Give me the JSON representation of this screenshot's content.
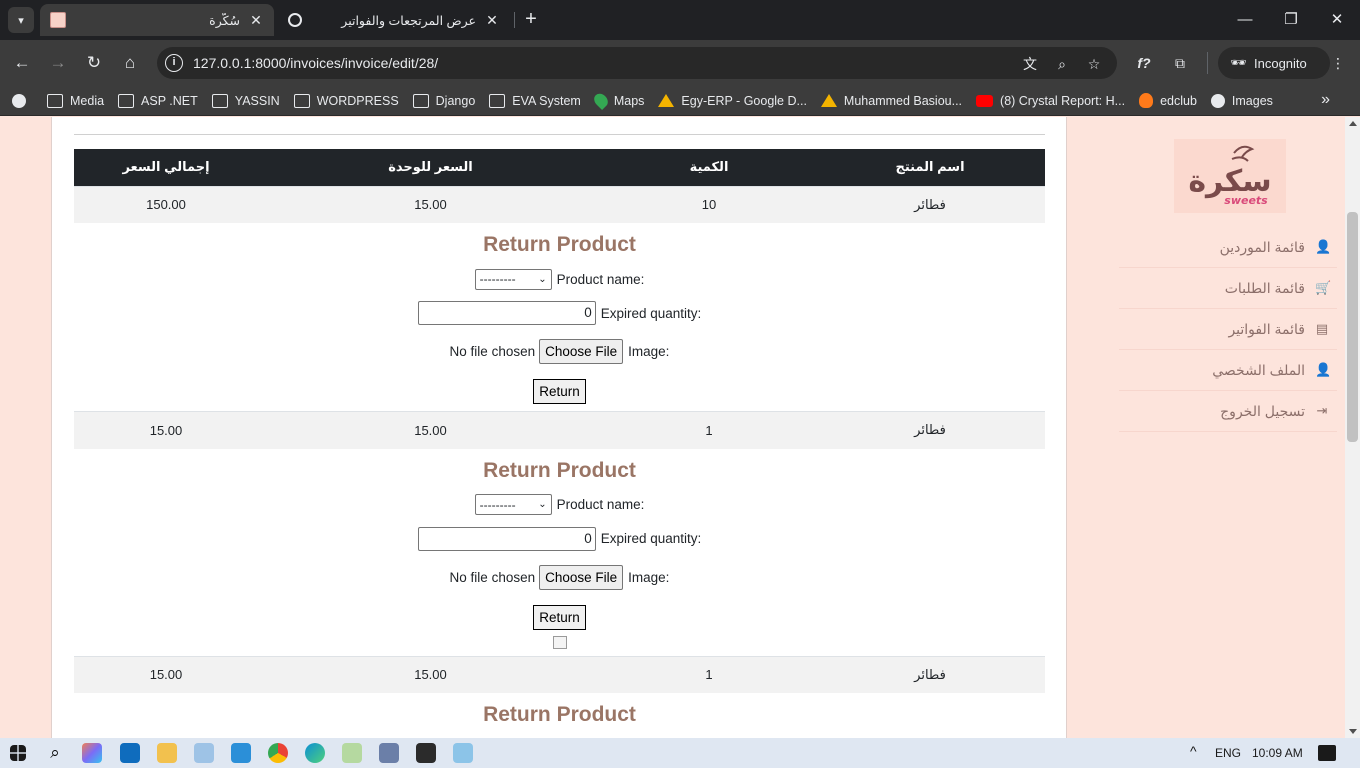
{
  "browser": {
    "tabs": [
      {
        "title": "سُكّرة",
        "active": true
      },
      {
        "title": "عرض المرتجعات والفواتير",
        "active": false
      }
    ],
    "url": "127.0.0.1:8000/invoices/invoice/edit/28/",
    "profile_label": "Incognito",
    "bookmarks": [
      "Media",
      "ASP .NET",
      "YASSIN",
      "WORDPRESS",
      "Django",
      "EVA System",
      "Maps",
      "Egy-ERP - Google D...",
      "Muhammed Basiou...",
      "(8) Crystal Report: H...",
      "edclub",
      "Images"
    ]
  },
  "sidebar": {
    "logo_text": "سكرة",
    "logo_sub": "sweets",
    "items": [
      {
        "label": "قائمة الموردين",
        "icon": "user-icon"
      },
      {
        "label": "قائمة الطلبات",
        "icon": "cart-icon"
      },
      {
        "label": "قائمة الفواتير",
        "icon": "document-icon"
      },
      {
        "label": "الملف الشخصي",
        "icon": "user-icon"
      },
      {
        "label": "تسجيل الخروج",
        "icon": "sign-out-icon"
      }
    ]
  },
  "table": {
    "headers": [
      "اسم المنتج",
      "الكمية",
      "السعر للوحدة",
      "إجمالي السعر"
    ],
    "rows": [
      {
        "name": "فطائر",
        "qty": "10",
        "price": "15.00",
        "total": "150.00"
      },
      {
        "name": "فطائر",
        "qty": "1",
        "price": "15.00",
        "total": "15.00"
      },
      {
        "name": "فطائر",
        "qty": "1",
        "price": "15.00",
        "total": "15.00"
      }
    ]
  },
  "return_form": {
    "title": "Return Product",
    "product_label": "Product name:",
    "product_value": "---------",
    "qty_label": "Expired quantity:",
    "qty_value": "0",
    "image_label": "Image:",
    "choose_file": "Choose File",
    "no_file": "No file chosen",
    "submit": "Return"
  },
  "taskbar": {
    "language": "ENG",
    "time": "10:09 AM"
  }
}
